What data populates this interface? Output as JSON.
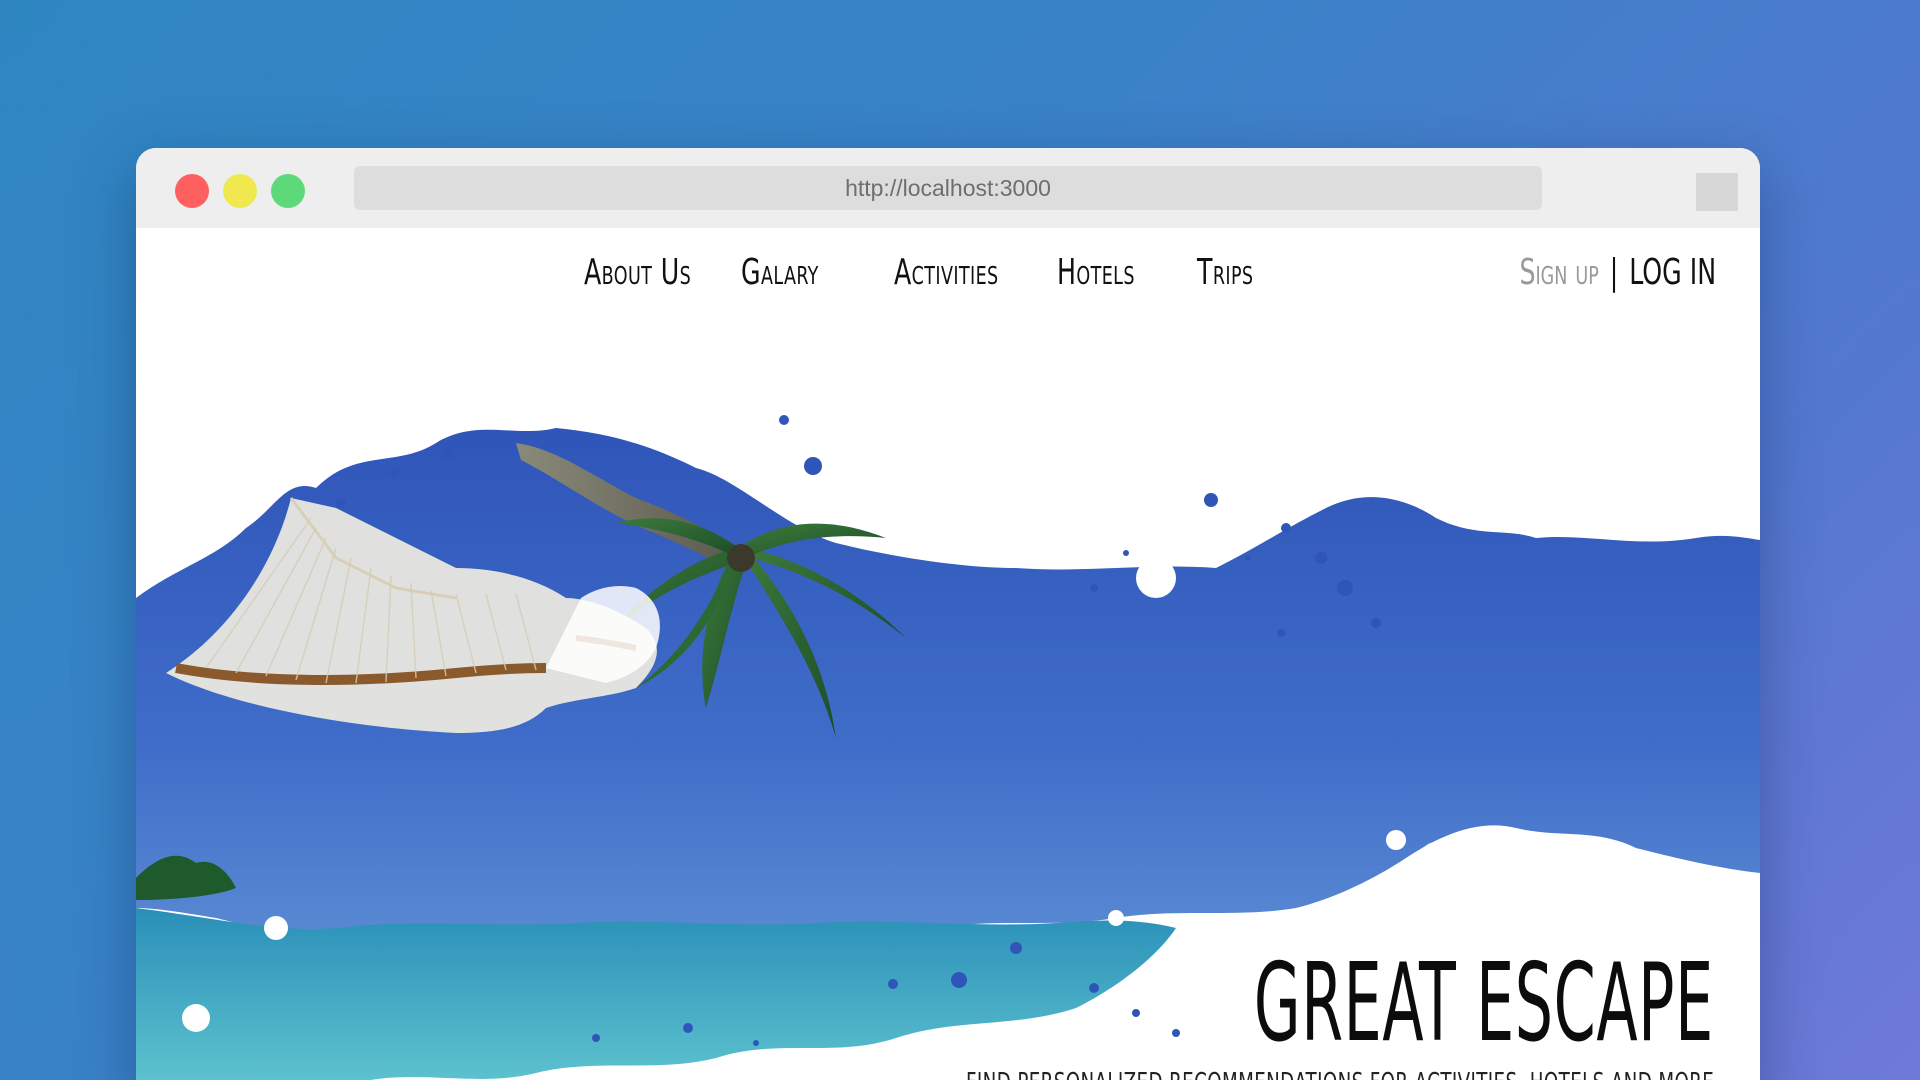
{
  "browser": {
    "url": "http://localhost:3000",
    "traffic_lights": {
      "close_color": "#fe6060",
      "minimize_color": "#f0e84f",
      "maximize_color": "#5dd97a"
    }
  },
  "nav": {
    "items": [
      {
        "label": "About Us"
      },
      {
        "label": "Galary"
      },
      {
        "label": "Activities"
      },
      {
        "label": "Hotels"
      },
      {
        "label": "Trips"
      }
    ],
    "sign_up": "Sign up",
    "separator": "|",
    "log_in": "LOG IN"
  },
  "hero": {
    "title": "GREAT ESCAPE",
    "subtitle": "Find personalized recommendations for activities, hotels and more",
    "sky_color": "#3c67c8",
    "sea_color": "#36a8c4"
  }
}
